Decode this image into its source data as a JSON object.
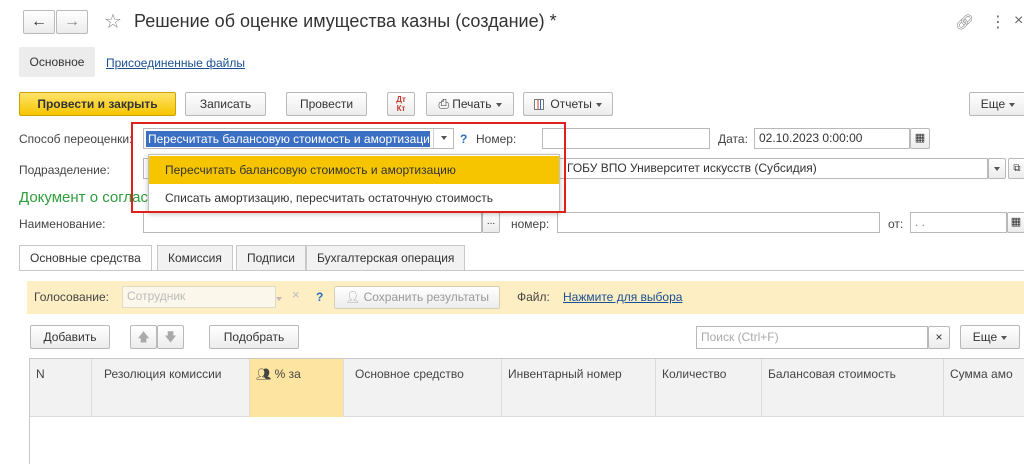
{
  "window": {
    "title": "Решение об оценке имущества казны (создание) *"
  },
  "nav_tabs": {
    "main": "Основное",
    "attached": "Присоединенные файлы"
  },
  "toolbar": {
    "post_close": "Провести и закрыть",
    "save": "Записать",
    "post": "Провести",
    "dt_kt": "Дт\nКт",
    "print": "Печать",
    "reports": "Отчеты",
    "more": "Еще"
  },
  "form": {
    "method_label": "Способ переоценки:",
    "method_value": "Пересчитать балансовую стоимость и амортизацию",
    "help": "?",
    "number_label": "Номер:",
    "date_label": "Дата:",
    "date_value": "02.10.2023  0:00:00",
    "division_label": "Подразделение:",
    "division_value": "ГОБУ ВПО Университет искусств (Субсидия)",
    "doc_section": "Документ о согласовании",
    "name_label": "Наименование:",
    "name_dots": "...",
    "num_label": "номер:",
    "from_label": "от:",
    "from_value": " .  ."
  },
  "dropdown": {
    "options": [
      "Пересчитать балансовую стоимость и амортизацию",
      "Списать амортизацию, пересчитать остаточную стоимость"
    ],
    "selected_index": 0
  },
  "tabs": [
    "Основные средства",
    "Комиссия",
    "Подписи",
    "Бухгалтерская операция"
  ],
  "voting": {
    "label": "Голосование:",
    "placeholder": "Сотрудник",
    "help": "?",
    "save_results": "Сохранить результаты",
    "file_label": "Файл:",
    "file_link": "Нажмите для выбора"
  },
  "table_toolbar": {
    "add": "Добавить",
    "pick": "Подобрать",
    "search_placeholder": "Поиск (Ctrl+F)",
    "clear": "×",
    "more": "Еще"
  },
  "table": {
    "columns": [
      "N",
      "Резолюция комиссии",
      "% за",
      "Основное средство",
      "Инвентарный номер",
      "Количество",
      "Балансовая стоимость",
      "Сумма амо"
    ]
  },
  "colors": {
    "accent_yellow": "#f6c500",
    "highlight_red": "#e0201c",
    "section_green": "#2e9d3c",
    "voting_bg": "#fdeec4"
  }
}
